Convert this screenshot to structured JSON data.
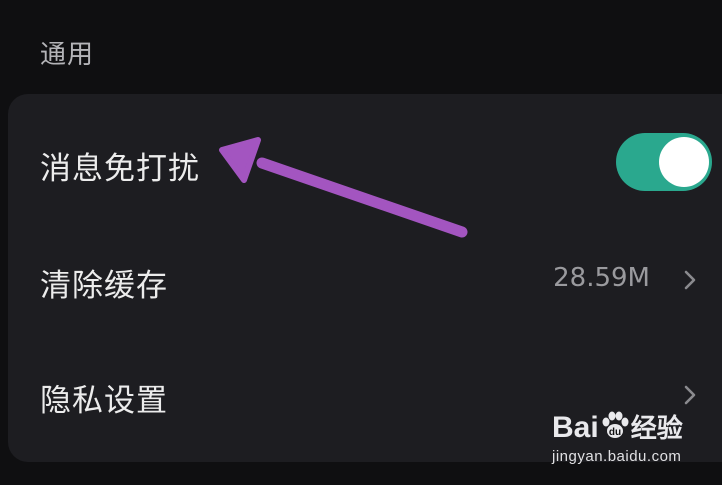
{
  "section": {
    "title": "通用"
  },
  "settings": {
    "dnd": {
      "label": "消息免打扰",
      "enabled": true,
      "toggle_color": "#2aa88e"
    },
    "clear_cache": {
      "label": "清除缓存",
      "value": "28.59M",
      "icon": "chevron-right-icon"
    },
    "privacy": {
      "label": "隐私设置",
      "icon": "chevron-right-icon"
    }
  },
  "annotation": {
    "color": "#a355c0",
    "icon": "arrow-icon"
  },
  "watermark": {
    "logo_text": "Bai",
    "logo_suffix": "经验",
    "url": "jingyan.baidu.com"
  }
}
